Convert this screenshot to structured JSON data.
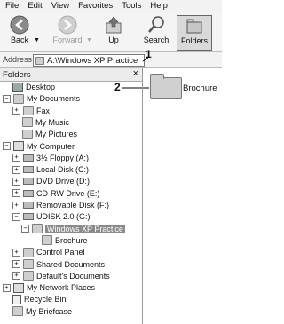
{
  "menu": [
    "File",
    "Edit",
    "View",
    "Favorites",
    "Tools",
    "Help"
  ],
  "toolbar": {
    "back": "Back",
    "forward": "Forward",
    "up": "Up",
    "search": "Search",
    "folders": "Folders"
  },
  "address": {
    "label": "Address",
    "value": "A:\\Windows XP Practice"
  },
  "callouts": [
    "1",
    "2"
  ],
  "folders_pane": {
    "title": "Folders",
    "close": "×",
    "items": [
      {
        "label": "Desktop",
        "exp": "",
        "icon": "desktop"
      },
      {
        "label": "My Documents",
        "exp": "−",
        "icon": "folder"
      },
      {
        "label": "Fax",
        "exp": "+",
        "icon": "folder"
      },
      {
        "label": "My Music",
        "exp": "",
        "icon": "folder"
      },
      {
        "label": "My Pictures",
        "exp": "",
        "icon": "folder"
      },
      {
        "label": "My Computer",
        "exp": "−",
        "icon": "computer"
      },
      {
        "label": "3½ Floppy (A:)",
        "exp": "+",
        "icon": "drive"
      },
      {
        "label": "Local Disk (C:)",
        "exp": "+",
        "icon": "drive"
      },
      {
        "label": "DVD Drive (D:)",
        "exp": "+",
        "icon": "drive"
      },
      {
        "label": "CD-RW Drive (E:)",
        "exp": "+",
        "icon": "drive"
      },
      {
        "label": "Removable Disk (F:)",
        "exp": "+",
        "icon": "drive"
      },
      {
        "label": "UDISK 2.0 (G:)",
        "exp": "−",
        "icon": "drive"
      },
      {
        "label": "Windows XP Practice",
        "exp": "−",
        "icon": "folder",
        "selected": true
      },
      {
        "label": "Brochure",
        "exp": "",
        "icon": "folder"
      },
      {
        "label": "Control Panel",
        "exp": "+",
        "icon": "folder"
      },
      {
        "label": "Shared Documents",
        "exp": "+",
        "icon": "folder"
      },
      {
        "label": "Default's Documents",
        "exp": "+",
        "icon": "folder"
      },
      {
        "label": "My Network Places",
        "exp": "+",
        "icon": "network"
      },
      {
        "label": "Recycle Bin",
        "exp": "",
        "icon": "bin"
      },
      {
        "label": "My Briefcase",
        "exp": "",
        "icon": "briefcase"
      }
    ]
  },
  "content": {
    "items": [
      {
        "label": "Brochure",
        "icon": "folder"
      }
    ]
  }
}
